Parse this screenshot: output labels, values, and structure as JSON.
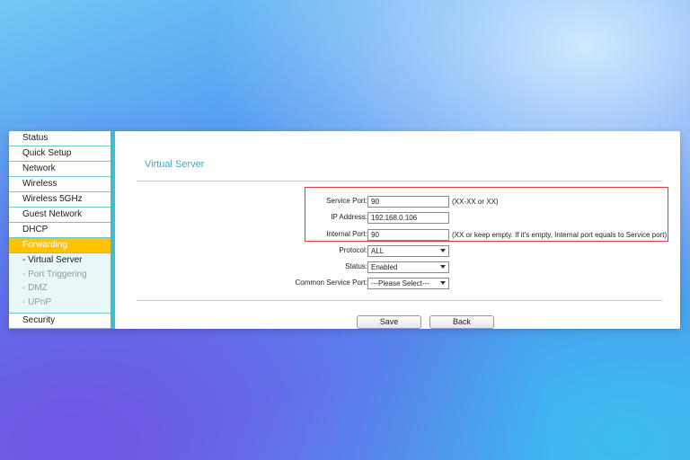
{
  "sidebar": {
    "items": [
      {
        "label": "Status"
      },
      {
        "label": "Quick Setup"
      },
      {
        "label": "Network"
      },
      {
        "label": "Wireless"
      },
      {
        "label": "Wireless 5GHz"
      },
      {
        "label": "Guest Network"
      },
      {
        "label": "DHCP"
      },
      {
        "label": "Forwarding"
      }
    ],
    "sub_items": [
      {
        "label": "- Virtual Server"
      },
      {
        "label": "- Port Triggering"
      },
      {
        "label": "- DMZ"
      },
      {
        "label": "- UPnP"
      }
    ],
    "after_items": [
      {
        "label": "Security"
      }
    ]
  },
  "page": {
    "title": "Virtual Server"
  },
  "form": {
    "service_port": {
      "label": "Service Port:",
      "value": "90",
      "hint": "(XX-XX or XX)"
    },
    "ip_address": {
      "label": "IP Address:",
      "value": "192.168.0.106"
    },
    "internal_port": {
      "label": "Internal Port:",
      "value": "90",
      "hint": "(XX or keep empty. If it's empty, Internal port equals to Service port)"
    },
    "protocol": {
      "label": "Protocol:",
      "value": "ALL"
    },
    "status": {
      "label": "Status:",
      "value": "Enabled"
    },
    "common_service_port": {
      "label": "Common Service Port:",
      "value": "---Please Select---"
    }
  },
  "buttons": {
    "save": "Save",
    "back": "Back"
  },
  "colors": {
    "accent": "#ffc300",
    "sidebar_bar": "#3cc0cf",
    "title": "#44a9c2",
    "highlight": "#e03a3a"
  }
}
